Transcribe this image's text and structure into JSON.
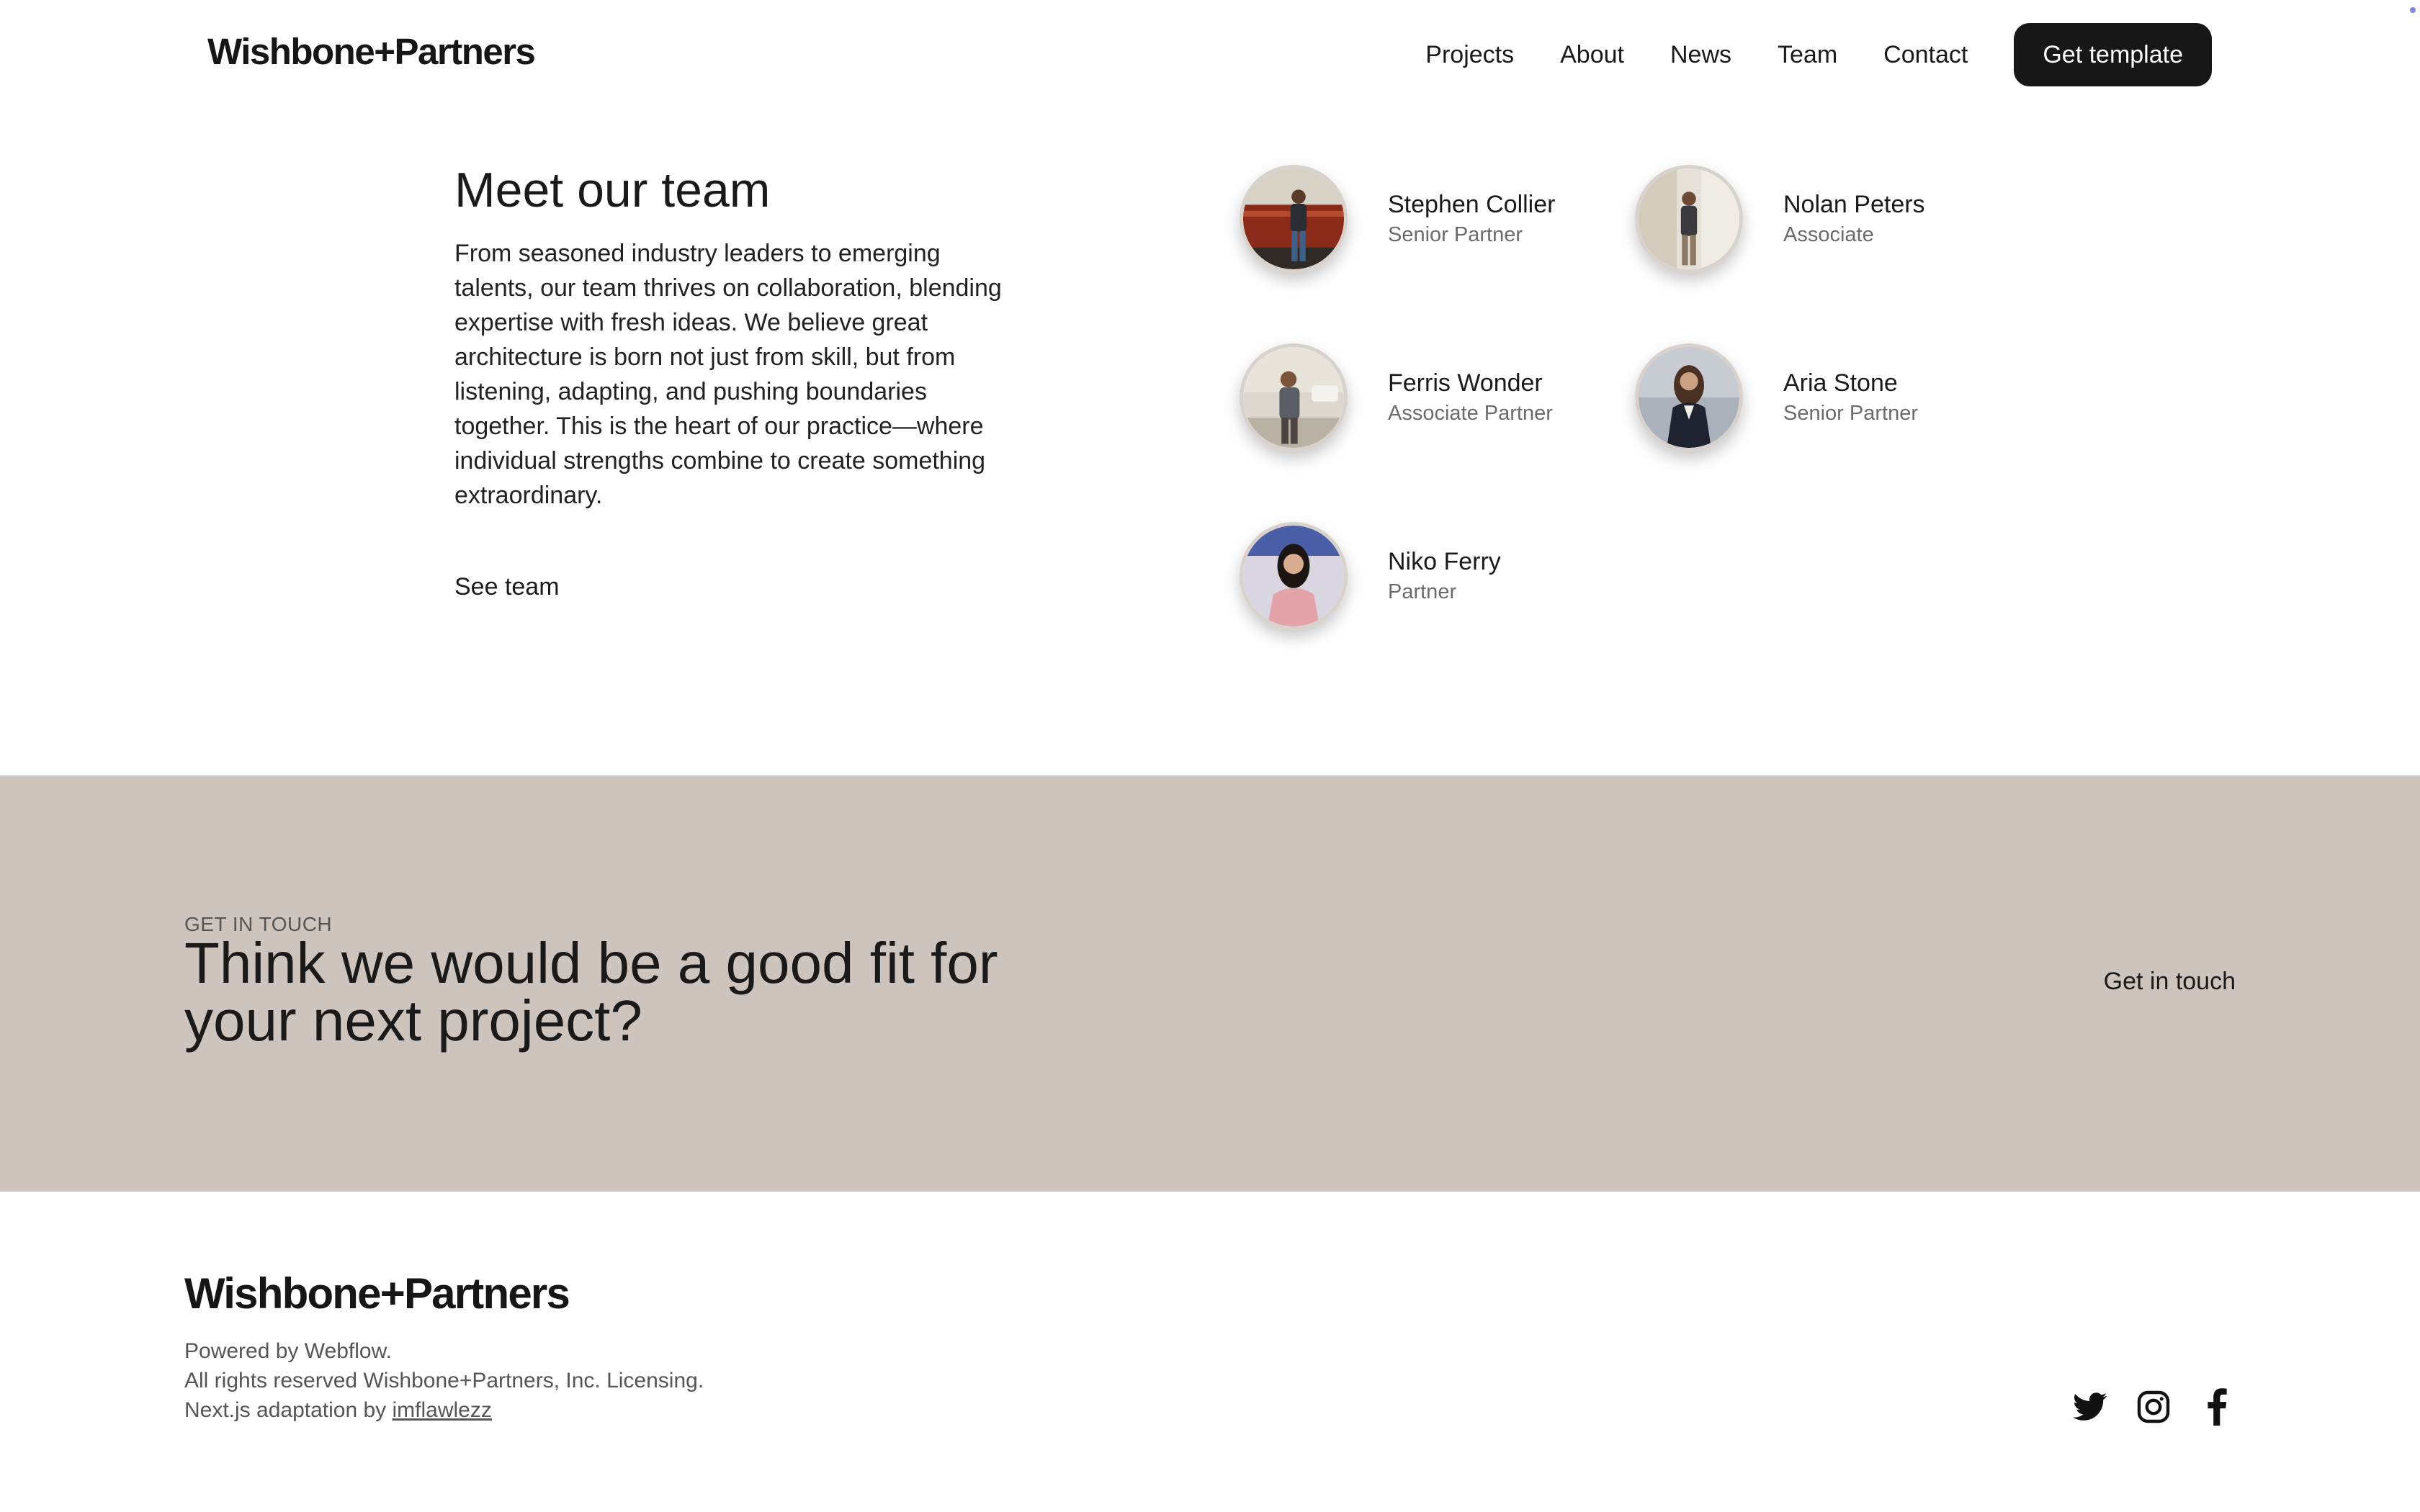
{
  "header": {
    "brand": "Wishbone+Partners",
    "nav": [
      "Projects",
      "About",
      "News",
      "Team",
      "Contact"
    ],
    "cta_label": "Get template"
  },
  "team": {
    "heading": "Meet our team",
    "body": "From seasoned industry leaders to emerging talents, our team thrives on collaboration, blending expertise with fresh ideas. We believe great architecture is born not just from skill, but from listening, adapting, and pushing boundaries together. This is the heart of our practice—where individual strengths combine to create something extraordinary.",
    "see_team": "See team",
    "members": [
      {
        "name": "Stephen Collier",
        "role": "Senior Partner"
      },
      {
        "name": "Nolan Peters",
        "role": "Associate"
      },
      {
        "name": "Ferris Wonder",
        "role": "Associate Partner"
      },
      {
        "name": "Aria Stone",
        "role": "Senior Partner"
      },
      {
        "name": "Niko Ferry",
        "role": "Partner"
      }
    ]
  },
  "cta": {
    "eyebrow": "GET IN TOUCH",
    "heading": "Think we would be a good fit for your next project?",
    "link": "Get in touch",
    "background": "#cdc4bd"
  },
  "footer": {
    "brand": "Wishbone+Partners",
    "powered": "Powered by Webflow.",
    "rights": "All rights reserved Wishbone+Partners, Inc. Licensing.",
    "adaptation_prefix": "Next.js adaptation by",
    "adaptation_author": "imflawlezz",
    "socials": [
      "twitter-icon",
      "instagram-icon",
      "facebook-icon"
    ]
  },
  "colors": {
    "button_bg": "#171717",
    "text": "#1a1a1a",
    "muted": "#6b6b6b"
  }
}
